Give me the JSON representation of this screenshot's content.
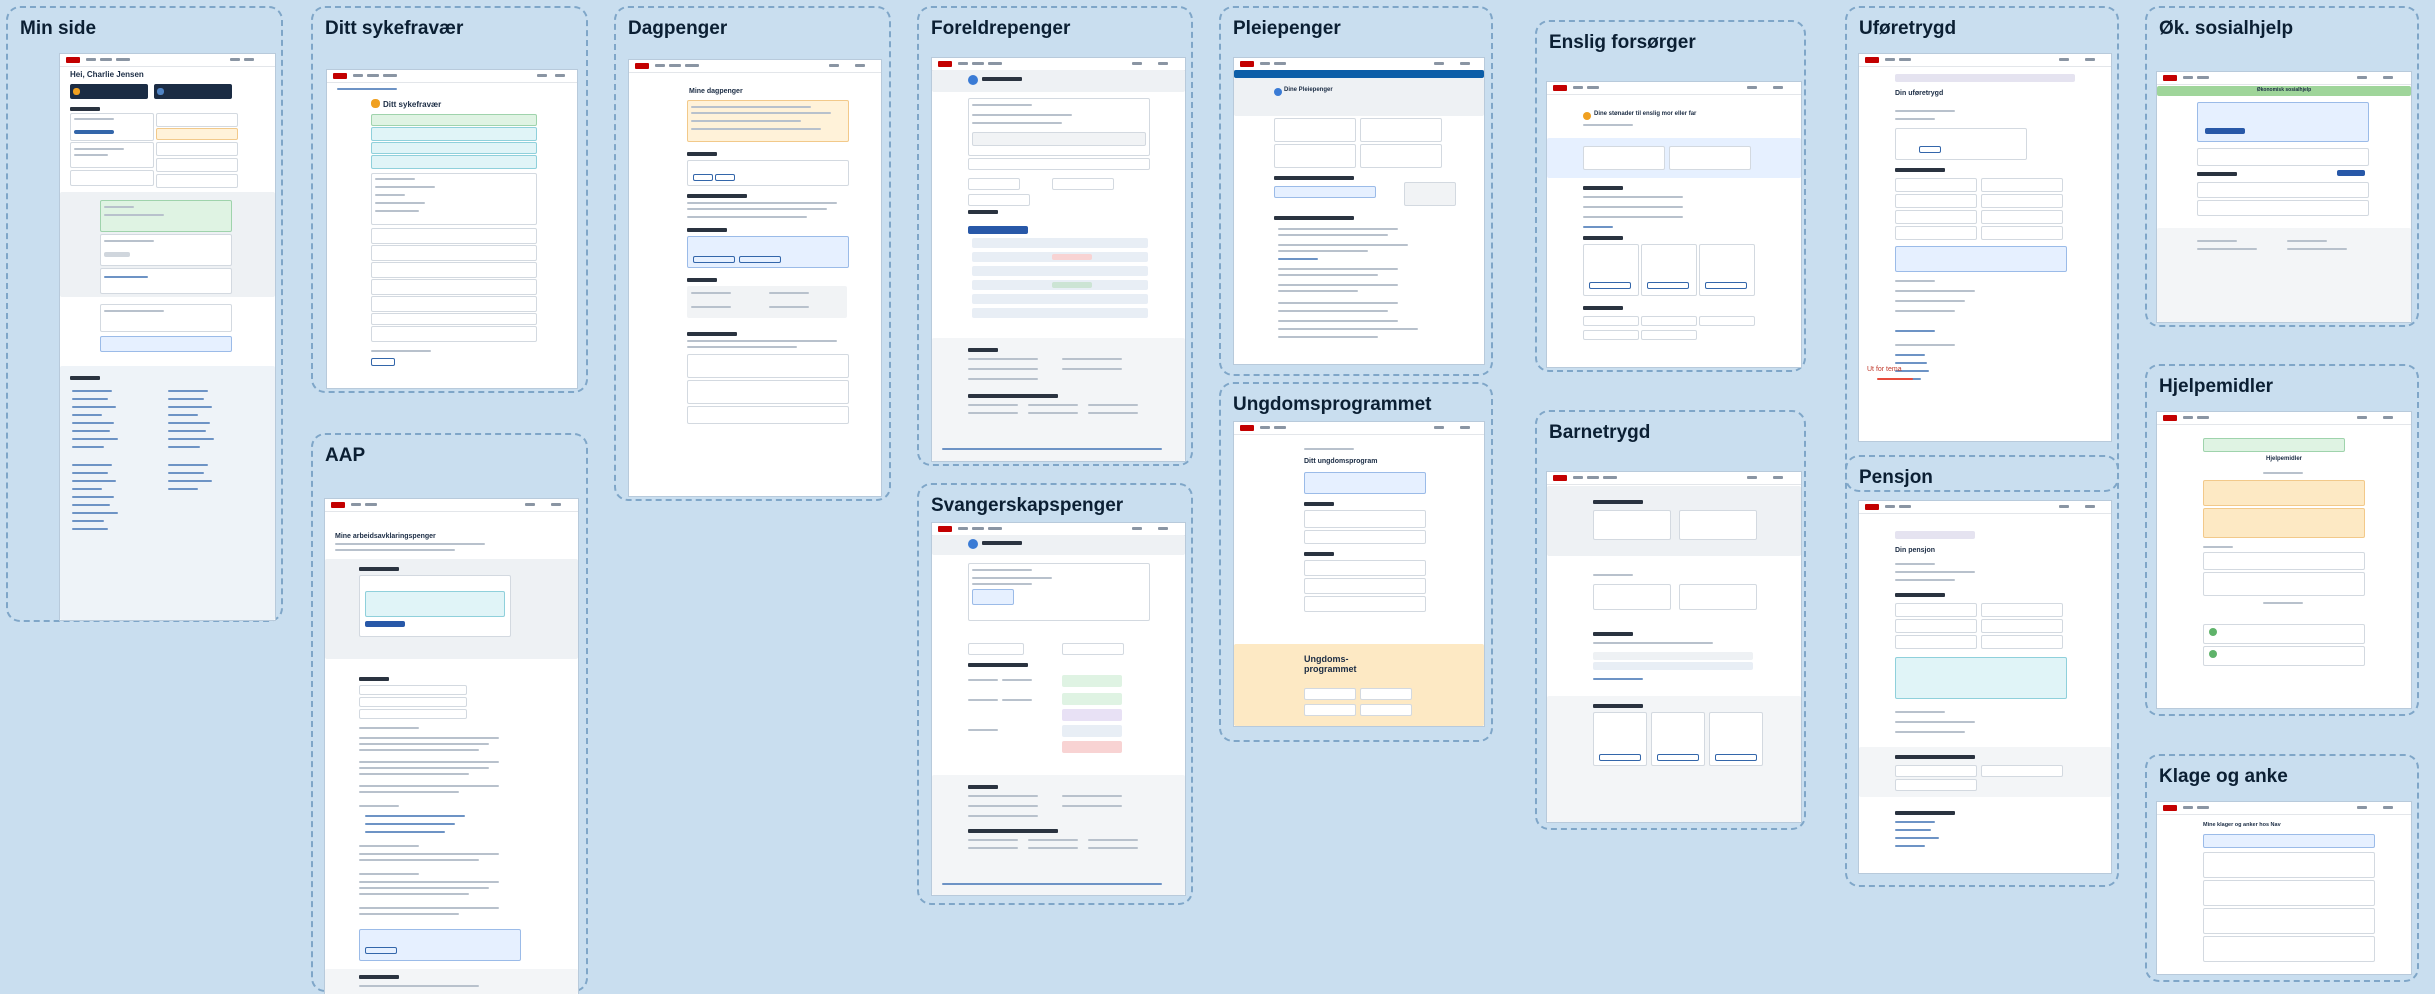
{
  "sections": {
    "min_side": "Min side",
    "ditt_sykefravaer": "Ditt sykefravær",
    "dagpenger": "Dagpenger",
    "foreldrepenger": "Foreldrepenger",
    "pleiepenger": "Pleiepenger",
    "enslig_forsorger": "Enslig forsørger",
    "uforetrygd": "Uføretrygd",
    "ok_sosialhjelp": "Øk. sosialhjelp",
    "aap": "AAP",
    "svangerskapspenger": "Svangerskapspenger",
    "ungdomsprogrammet": "Ungdomsprogrammet",
    "barnetrygd": "Barnetrygd",
    "pensjon": "Pensjon",
    "hjelpemidler": "Hjelpemidler",
    "klage_og_anke": "Klage og anke"
  },
  "min_side": {
    "greeting": "Hei, Charlie Jensen"
  },
  "sykefravaer": {
    "heading": "Ditt sykefravær"
  },
  "dagpenger": {
    "heading": "Mine dagpenger"
  },
  "pleiepenger": {
    "heading": "Dine Pleiepenger"
  },
  "ungdomsprogrammet": {
    "heading": "Ditt ungdomsprogram",
    "banner": "Ungdoms-programmet"
  },
  "enslig": {
    "heading": "Dine stønader til enslig mor eller far"
  },
  "uforetrygd": {
    "heading": "Din uføretrygd",
    "callout": "Ut for tema"
  },
  "sosialhjelp": {
    "banner": "Økonomisk sosialhjelp"
  },
  "hjelpemidler": {
    "heading": "Hjelpemidler"
  },
  "aap": {
    "heading": "Mine arbeidsavklaringspenger"
  },
  "pensjon": {
    "heading": "Din pensjon"
  },
  "klage": {
    "heading": "Mine klager og anker hos Nav"
  },
  "colors": {
    "nav_red": "#c30000",
    "info_blue": "#e6f0ff",
    "success_green": "#dff3e3",
    "warning_orange": "#fff2d9",
    "dark_navy": "#1b2c44"
  }
}
